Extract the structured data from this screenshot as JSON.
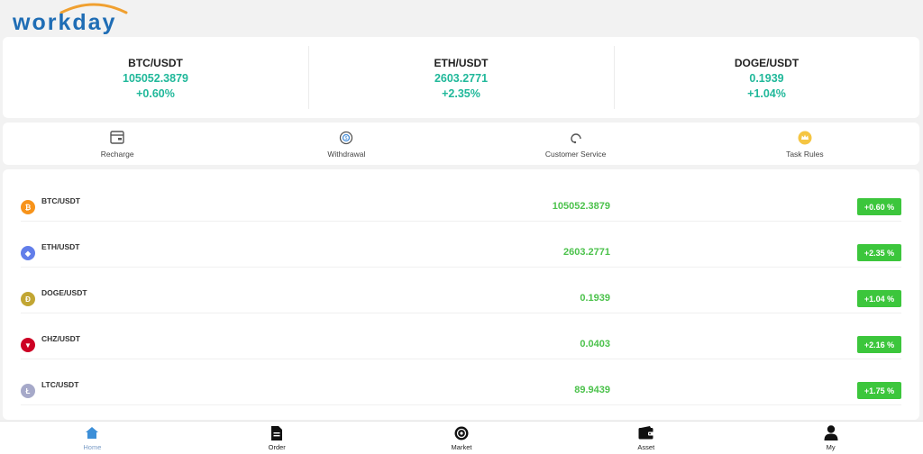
{
  "brand": {
    "name": "workday",
    "color": "#1f6db5",
    "arc_color": "#f0a030"
  },
  "tickers": [
    {
      "pair": "BTC/USDT",
      "price": "105052.3879",
      "change": "+0.60%"
    },
    {
      "pair": "ETH/USDT",
      "price": "2603.2771",
      "change": "+2.35%"
    },
    {
      "pair": "DOGE/USDT",
      "price": "0.1939",
      "change": "+1.04%"
    }
  ],
  "actions": [
    {
      "label": "Recharge",
      "icon": "wallet-card-icon"
    },
    {
      "label": "Withdrawal",
      "icon": "coin-withdraw-icon"
    },
    {
      "label": "Customer Service",
      "icon": "headset-icon"
    },
    {
      "label": "Task Rules",
      "icon": "crown-badge-icon"
    }
  ],
  "market": [
    {
      "pair": "BTC/USDT",
      "price": "105052.3879",
      "change": "+0.60 %",
      "icon": "bitcoin-icon",
      "color": "#f7931a",
      "glyph": "₿"
    },
    {
      "pair": "ETH/USDT",
      "price": "2603.2771",
      "change": "+2.35 %",
      "icon": "ethereum-icon",
      "color": "#627eea",
      "glyph": "◆"
    },
    {
      "pair": "DOGE/USDT",
      "price": "0.1939",
      "change": "+1.04 %",
      "icon": "dogecoin-icon",
      "color": "#c2a633",
      "glyph": "Ð"
    },
    {
      "pair": "CHZ/USDT",
      "price": "0.0403",
      "change": "+2.16 %",
      "icon": "chiliz-icon",
      "color": "#cd0124",
      "glyph": "▼"
    },
    {
      "pair": "LTC/USDT",
      "price": "89.9439",
      "change": "+1.75 %",
      "icon": "litecoin-icon",
      "color": "#a6a9c9",
      "glyph": "Ł"
    }
  ],
  "nav": [
    {
      "label": "Home",
      "icon": "home-icon",
      "active": true
    },
    {
      "label": "Order",
      "icon": "document-icon",
      "active": false
    },
    {
      "label": "Market",
      "icon": "market-icon",
      "active": false
    },
    {
      "label": "Asset",
      "icon": "wallet-icon",
      "active": false
    },
    {
      "label": "My",
      "icon": "person-icon",
      "active": false
    }
  ],
  "colors": {
    "positive_text": "#20b89a",
    "row_price": "#4cc24c",
    "badge_bg": "#3cc63c",
    "nav_active": "#7a9cc6"
  }
}
